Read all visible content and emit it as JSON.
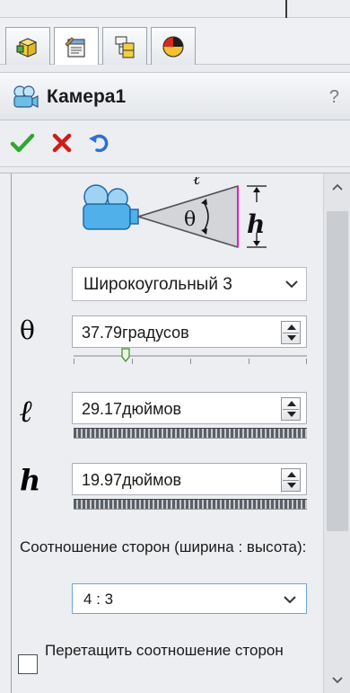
{
  "tabs": [
    {
      "id": "feature-manager",
      "icon": "cube-tree-icon",
      "active": false
    },
    {
      "id": "property-manager",
      "icon": "property-sheet-icon",
      "active": true
    },
    {
      "id": "configuration-manager",
      "icon": "configuration-icon",
      "active": false
    },
    {
      "id": "display-manager",
      "icon": "appearance-sphere-icon",
      "active": false
    }
  ],
  "header": {
    "title": "Камера1",
    "help_glyph": "?"
  },
  "actions": [
    {
      "id": "ok",
      "icon": "check-icon",
      "color": "#2fa82f"
    },
    {
      "id": "cancel",
      "icon": "x-icon",
      "color": "#d11a1a"
    },
    {
      "id": "undo",
      "icon": "undo-icon",
      "color": "#2a6fdb"
    }
  ],
  "lens": {
    "preset": "Широкоугольный 3"
  },
  "fields": {
    "angle": {
      "symbol": "θ",
      "value": "37.79градусов",
      "slider_fraction": 0.21
    },
    "distance": {
      "symbol": "ℓ",
      "value": "29.17дюймов"
    },
    "height": {
      "symbol": "h",
      "value": "19.97дюймов"
    }
  },
  "aspect": {
    "label": "Соотношение сторон (ширина : высота):",
    "value": "4 : 3"
  },
  "drag_aspect": {
    "label": "Перетащить соотношение сторон",
    "checked": false
  },
  "colors": {
    "accent_green": "#2fa82f",
    "accent_red": "#d11a1a",
    "accent_blue": "#2a6fdb",
    "focus_border": "#6aa6e6",
    "magenta_line": "#e020c0"
  }
}
